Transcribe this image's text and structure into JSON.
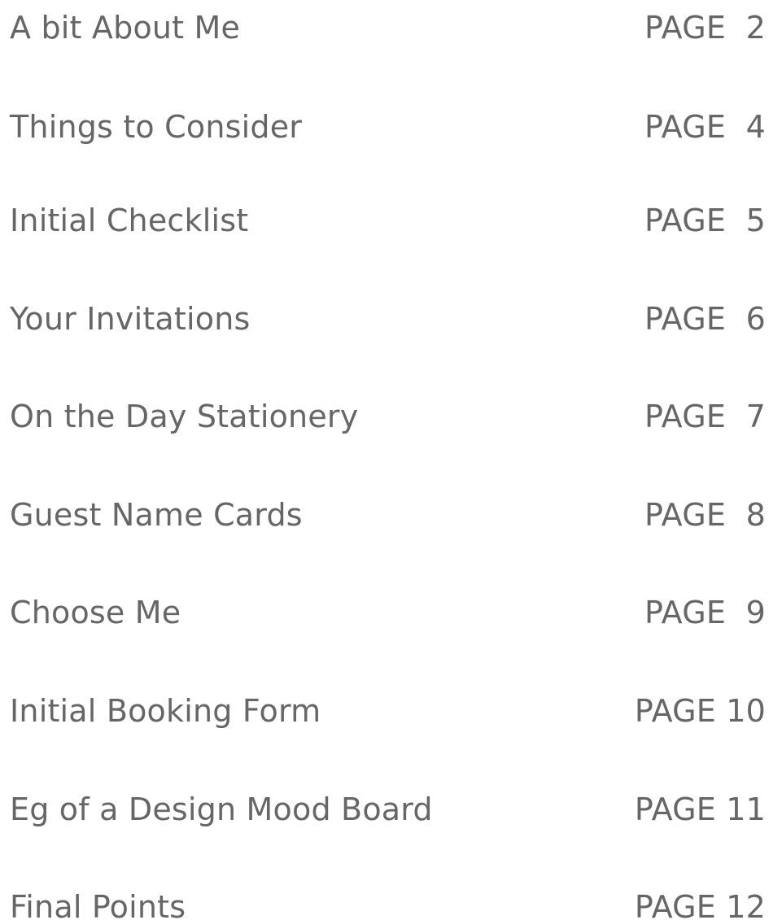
{
  "entries": [
    {
      "title": "A bit About Me",
      "page": "PAGE  2"
    },
    {
      "title": "Things to Consider",
      "page": "PAGE  4"
    },
    {
      "title": "Initial Checklist",
      "page": "PAGE  5"
    },
    {
      "title": "Your Invitations",
      "page": "PAGE  6"
    },
    {
      "title": "On the Day Stationery",
      "page": "PAGE  7"
    },
    {
      "title": "Guest Name Cards",
      "page": "PAGE  8"
    },
    {
      "title": "Choose Me",
      "page": "PAGE  9"
    },
    {
      "title": "Initial Booking Form",
      "page": "PAGE 10"
    },
    {
      "title": "Eg of a Design Mood Board",
      "page": "PAGE 11"
    },
    {
      "title": "Final Points",
      "page": "PAGE 12"
    }
  ]
}
